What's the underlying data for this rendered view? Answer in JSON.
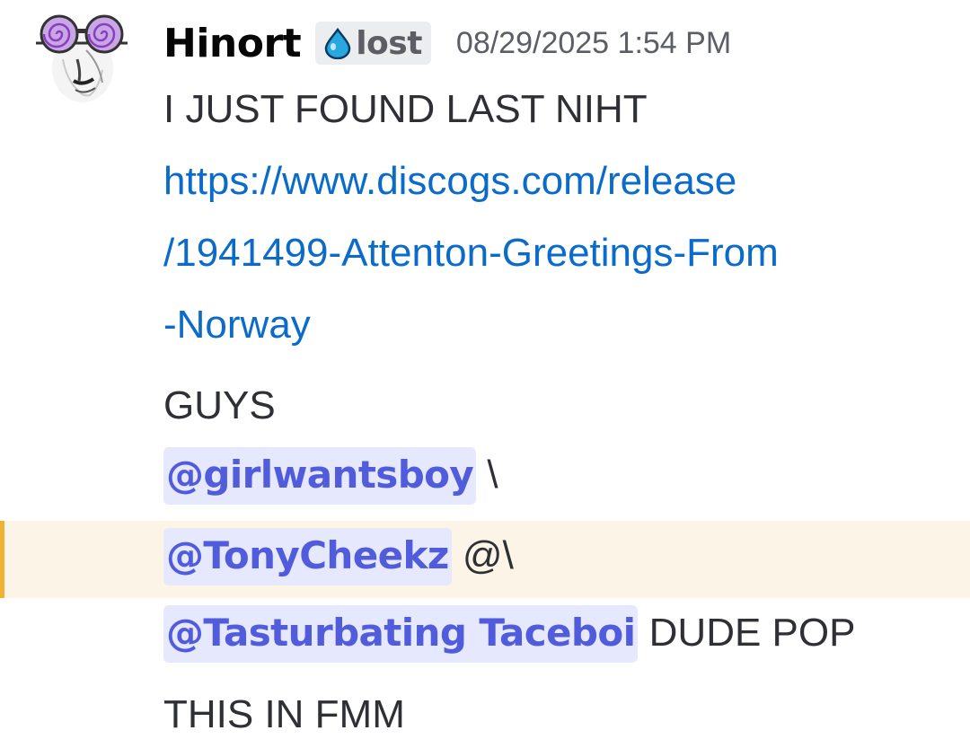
{
  "message": {
    "author": {
      "username": "Hinort",
      "avatar_icon": "swirl-glasses-face-avatar",
      "role_tag": {
        "icon": "water-drop-icon",
        "label": "lost",
        "icon_color": "#29a8e0"
      }
    },
    "timestamp": "08/29/2025 1:54 PM",
    "lines": {
      "line1": "I JUST FOUND LAST NIHT",
      "link_line1": "https://www.discogs.com/release",
      "link_line2": "/1941499-Attenton-Greetings-From",
      "link_line3": "-Norway",
      "guys": "GUYS",
      "mention1": "@girlwantsboy",
      "after_mention1": " \\",
      "mention2": "@TonyCheekz",
      "after_mention2": " @\\",
      "mention3": "@Tasturbating Taceboi",
      "after_mention3": " DUDE POP",
      "last_line": "THIS IN FMM"
    }
  },
  "colors": {
    "link": "#0b6bcb",
    "mention_text": "#505cdc",
    "mention_bg": "#e6e8fd",
    "highlight_bg": "#fcf4e7",
    "highlight_bar": "#f0b232"
  }
}
